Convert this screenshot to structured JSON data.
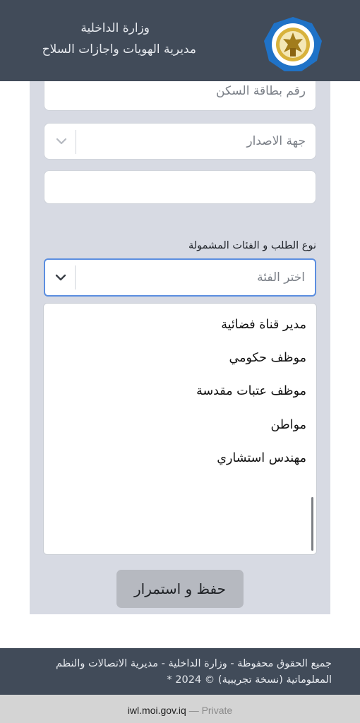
{
  "header": {
    "ministry": "وزارة الداخلية",
    "directorate": "مديرية الهويات واجازات السلاح",
    "logo_icon": "ministry-emblem-icon",
    "colors": {
      "bar": "#414b59",
      "logo_ring": "#1f72c7",
      "logo_gold": "#d8b23c"
    }
  },
  "form": {
    "residence_card_placeholder": "رقم بطاقة السكن",
    "issuer_placeholder": "جهة الاصدار",
    "blank_field_value": "",
    "category_label": "نوع الطلب و الفئات المشمولة",
    "category_placeholder": "اختر الفئة",
    "chevron_icon": "chevron-down-icon",
    "focus_color": "#5b8ee0"
  },
  "dropdown": {
    "options": [
      "مدير قناة فضائية",
      "موظف حكومي",
      "موظف عتبات مقدسة",
      "مواطن",
      "مهندس استشاري"
    ]
  },
  "save_button": "حفظ و استمرار",
  "footer": {
    "line1": "جميع الحقوق محفوظة - وزارة الداخلية - مديرية الاتصالات والنظم",
    "line2": "المعلوماتية (نسخة تجريبية) © 2024 *"
  },
  "browser": {
    "domain": "iwl.moi.gov.iq",
    "mode": "— Private"
  }
}
